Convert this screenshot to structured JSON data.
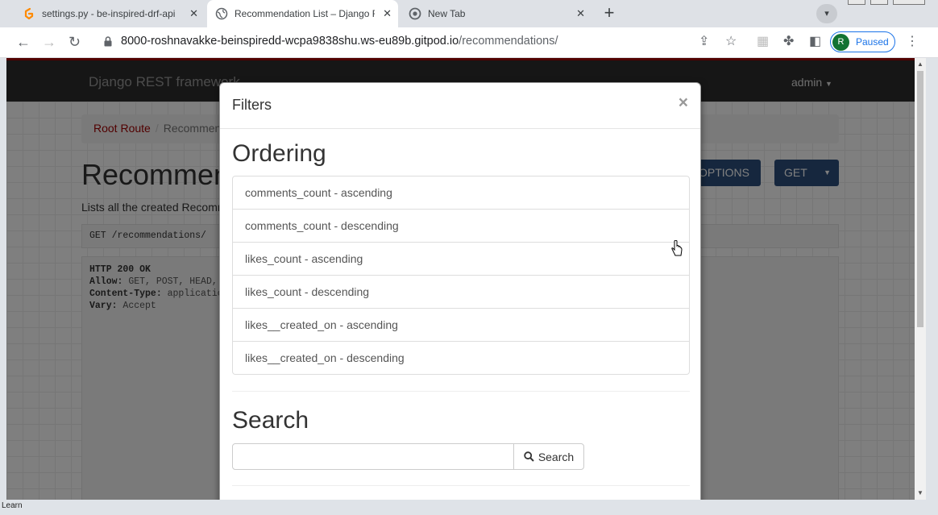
{
  "tabs": [
    {
      "title": "settings.py - be-inspired-drf-api",
      "icon": "gitpod-icon",
      "active": false
    },
    {
      "title": "Recommendation List – Django REST framework",
      "icon": "globe-icon",
      "active": true
    },
    {
      "title": "New Tab",
      "icon": "chrome-icon",
      "active": false
    }
  ],
  "toolbar": {
    "url_host": "8000-roshnavakke-beinspiredd-wcpa9838shu.ws-eu89b.gitpod.io",
    "url_path": "/recommendations/",
    "profile_initial": "R",
    "profile_status": "Paused"
  },
  "page": {
    "brand": "Django REST framework",
    "user": "admin",
    "breadcrumb_root": "Root Route",
    "breadcrumb_current": "Recommendation List",
    "heading": "Recommendation List",
    "description": "Lists all the created Recommendations",
    "options_label": "OPTIONS",
    "get_label": "GET",
    "request": "GET /recommendations/",
    "response_header": "HTTP 200 OK",
    "response_allow_key": "Allow:",
    "response_allow_value": "GET, POST, HEAD, OPTIONS",
    "response_ct_key": "Content-Type:",
    "response_ct_value": "application/json",
    "response_vary_key": "Vary:",
    "response_vary_value": "Accept"
  },
  "modal": {
    "title": "Filters",
    "close": "×",
    "ordering_heading": "Ordering",
    "ordering_items": [
      "comments_count - ascending",
      "comments_count - descending",
      "likes_count - ascending",
      "likes_count - descending",
      "likes__created_on - ascending",
      "likes__created_on - descending"
    ],
    "search_heading": "Search",
    "search_value": "",
    "search_button": "Search"
  },
  "statusbar": {
    "text": "Learn"
  },
  "colors": {
    "accent": "#a30000",
    "button": "#2c4f7c",
    "navbar": "#2c2c2c"
  }
}
